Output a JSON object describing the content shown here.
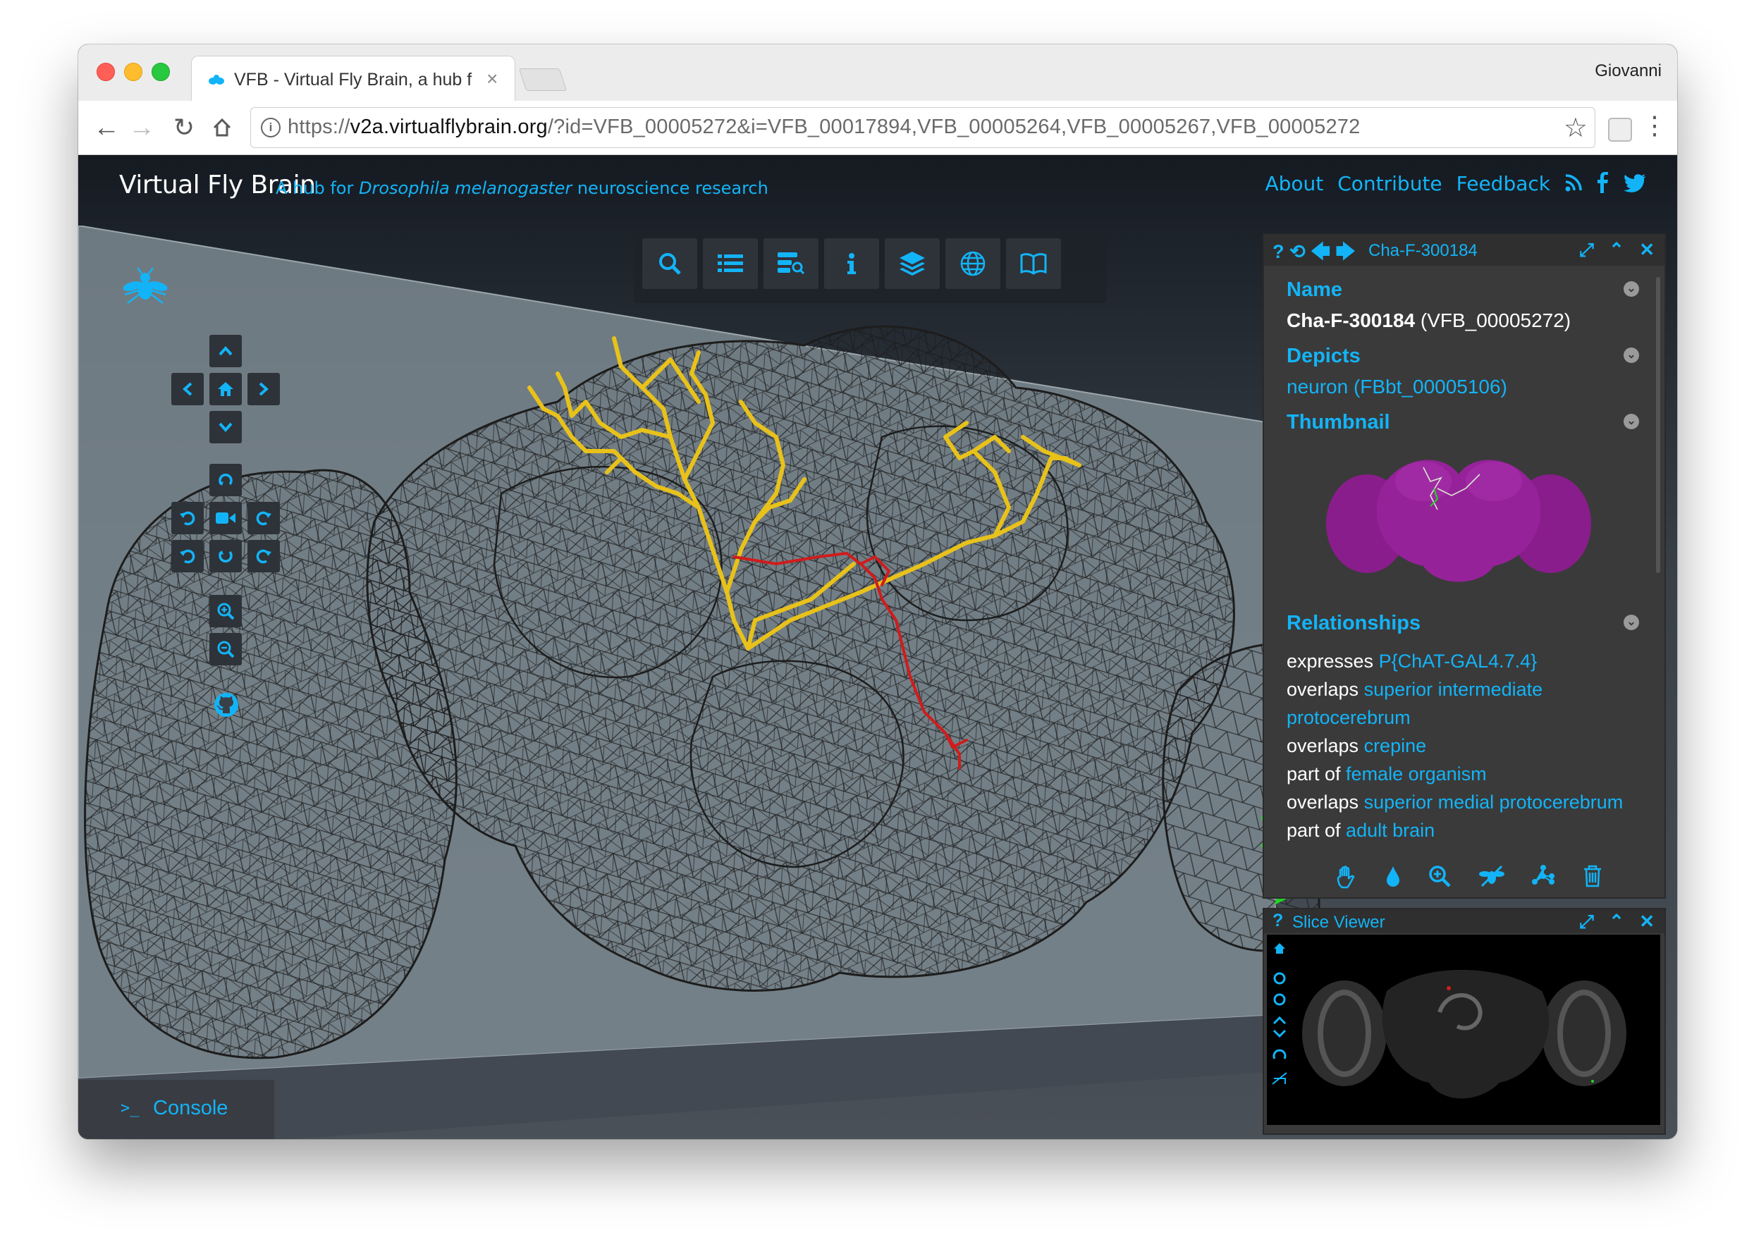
{
  "browser": {
    "tab_title": "VFB - Virtual Fly Brain, a hub f",
    "tab_close": "×",
    "profile_name": "Giovanni",
    "url_scheme": "https://",
    "url_host": "v2a.virtualflybrain.org",
    "url_path": "/?id=VFB_00005272&i=VFB_00017894,VFB_00005264,VFB_00005267,VFB_00005272"
  },
  "header": {
    "logo": "Virtual Fly Brain",
    "tagline_prefix": "A hub for ",
    "tagline_species": "Drosophila melanogaster",
    "tagline_suffix": " neuroscience research",
    "links": [
      "About",
      "Contribute",
      "Feedback"
    ]
  },
  "toolbar": {
    "icons": [
      "search-icon",
      "list-icon",
      "query-icon",
      "info-icon",
      "layers-icon",
      "globe-icon",
      "book-icon"
    ]
  },
  "term_info": {
    "title": "Cha-F-300184",
    "name_heading": "Name",
    "name_label": "Cha-F-300184",
    "name_id": "(VFB_00005272)",
    "depicts_heading": "Depicts",
    "depicts_value": "neuron (FBbt_00005106)",
    "thumbnail_heading": "Thumbnail",
    "relationships_heading": "Relationships",
    "relationships": [
      {
        "rel": "expresses ",
        "target": "P{ChAT-GAL4.7.4}"
      },
      {
        "rel": "overlaps ",
        "target": "superior intermediate protocerebrum"
      },
      {
        "rel": "overlaps ",
        "target": "crepine"
      },
      {
        "rel": "part of ",
        "target": "female organism"
      },
      {
        "rel": "overlaps ",
        "target": "superior medial protocerebrum"
      },
      {
        "rel": "part of ",
        "target": "adult brain"
      }
    ]
  },
  "slice_viewer": {
    "title": "Slice Viewer"
  },
  "console": {
    "label": "Console"
  },
  "colors": {
    "accent": "#13b4f7",
    "neuron_yellow": "#e8c21a",
    "neuron_red": "#d01c1c",
    "neuron_green": "#22d422",
    "thumbnail_magenta": "#8a1d8c"
  }
}
